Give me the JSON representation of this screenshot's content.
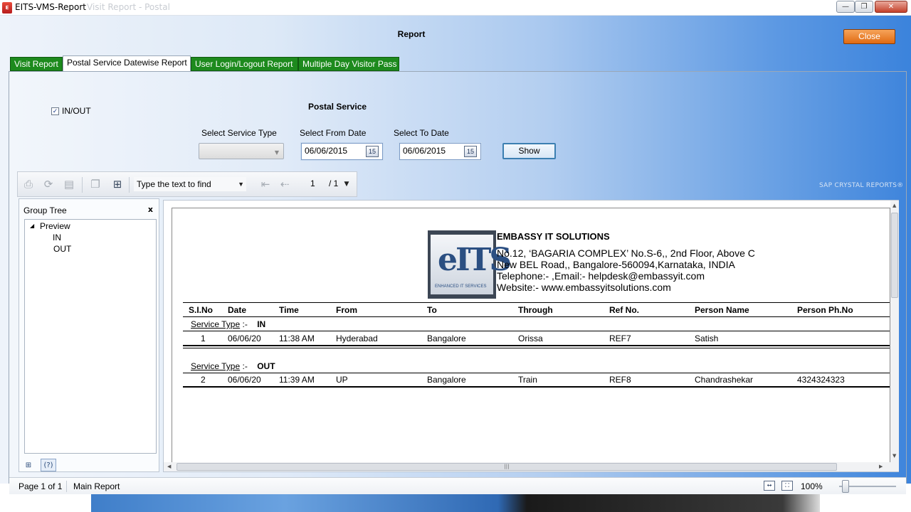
{
  "window": {
    "title": "EITS-VMS-Report",
    "title_ghost": "Visit Report - Postal",
    "min_glyph": "—",
    "max_glyph": "❐",
    "close_glyph": "✕"
  },
  "header": {
    "title": "Report",
    "close_label": "Close"
  },
  "tabs": [
    {
      "label": "Visit Report",
      "active": false
    },
    {
      "label": "Postal Service Datewise Report",
      "active": true
    },
    {
      "label": "User Login/Logout Report",
      "active": false
    },
    {
      "label": "Multiple Day Visitor Pass",
      "active": false
    }
  ],
  "filters": {
    "inout_label": "IN/OUT",
    "inout_checked": true,
    "section_title": "Postal Service",
    "service_type_label": "Select Service Type",
    "service_type_value": "",
    "from_label": "Select From Date",
    "from_value": "06/06/2015",
    "to_label": "Select To Date",
    "to_value": "06/06/2015",
    "calendar_glyph": "15",
    "show_label": "Show"
  },
  "toolbar": {
    "find_placeholder": "Type the text to find",
    "page_current": "1",
    "page_total": "/ 1",
    "sap_label": "SAP CRYSTAL REPORTS®"
  },
  "group_tree": {
    "title": "Group Tree",
    "close": "x",
    "root": "Preview",
    "children": [
      "IN",
      "OUT"
    ],
    "expander": "◢"
  },
  "report": {
    "logo_text": "eITS",
    "logo_sub": "ENHANCED IT SERVICES",
    "company": "EMBASSY IT SOLUTIONS",
    "address1": "No.12, ‘BAGARIA COMPLEX’ No.S-6,, 2nd Floor, Above C",
    "address2": "New BEL Road,, Bangalore-560094,Karnataka, INDIA",
    "contact": "Telephone:- ,Email:- helpdesk@embassyit.com",
    "website": "Website:- www.embassyitsolutions.com",
    "columns": [
      "S.I.No",
      "Date",
      "Time",
      "From",
      "To",
      "Through",
      "Ref No.",
      "Person Name",
      "Person Ph.No"
    ],
    "service_type_label": "Service Type",
    "service_type_sep": ":-",
    "groups": [
      {
        "type": "IN",
        "rows": [
          {
            "sno": "1",
            "date": "06/06/20",
            "time": "11:38 AM",
            "from": "Hyderabad",
            "to": "Bangalore",
            "through": "Orissa",
            "ref": "REF7",
            "person": "Satish",
            "phone": ""
          }
        ]
      },
      {
        "type": "OUT",
        "rows": [
          {
            "sno": "2",
            "date": "06/06/20",
            "time": "11:39 AM",
            "from": "UP",
            "to": "Bangalore",
            "through": "Train",
            "ref": "REF8",
            "person": "Chandrashekar",
            "phone": "4324324323"
          }
        ]
      }
    ]
  },
  "status": {
    "page": "Page 1 of 1",
    "report": "Main Report",
    "zoom": "100%"
  }
}
